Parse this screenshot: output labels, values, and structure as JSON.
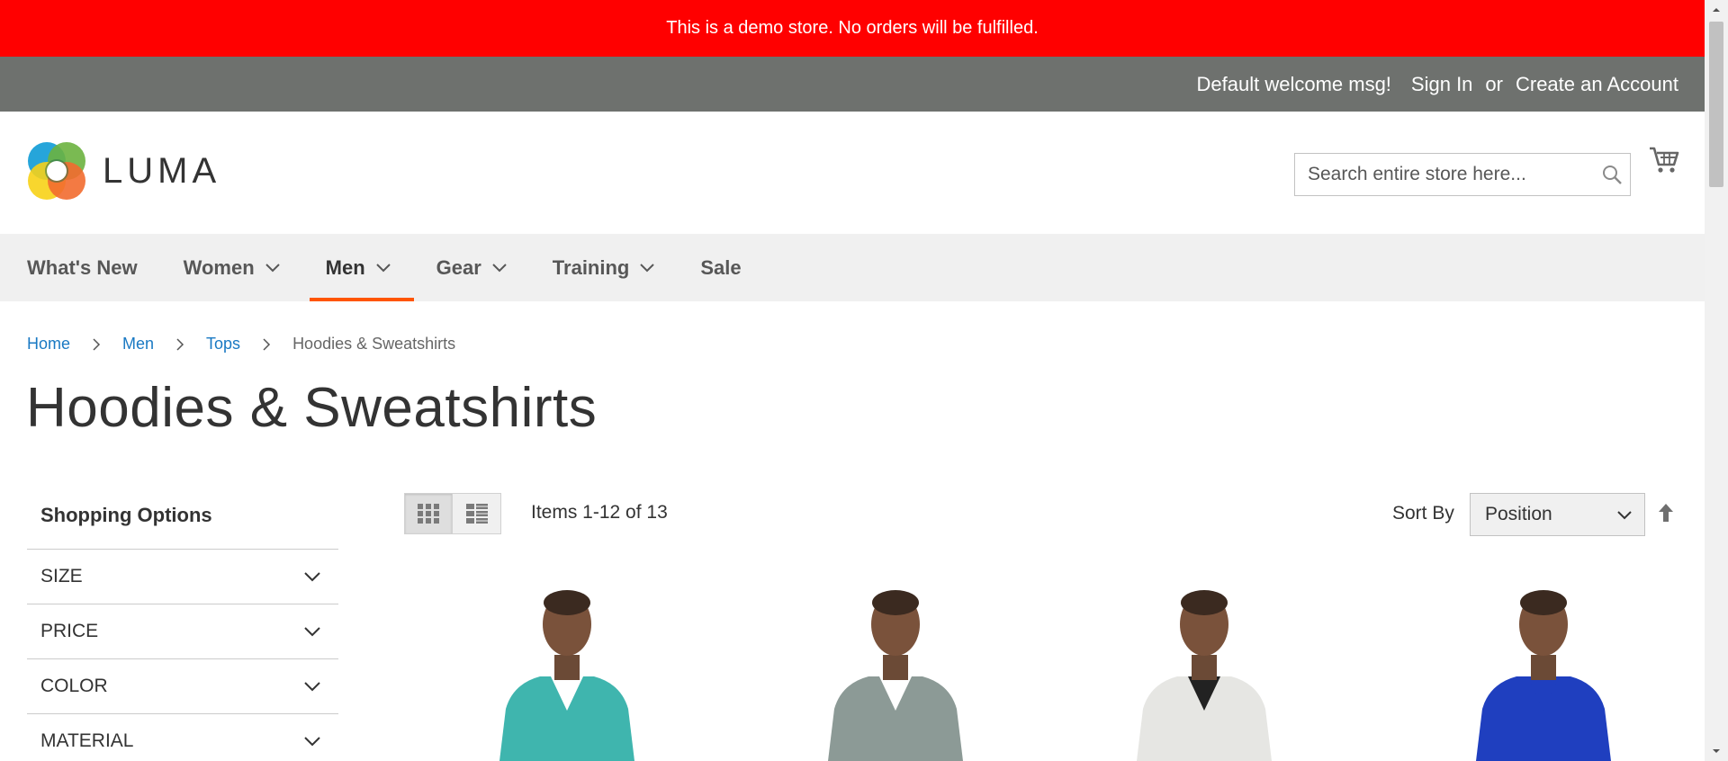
{
  "demo_notice": "This is a demo store. No orders will be fulfilled.",
  "panel": {
    "welcome": "Default welcome msg!",
    "sign_in": "Sign In",
    "or": "or",
    "create_account": "Create an Account"
  },
  "header": {
    "logo_text": "LUMA",
    "search_placeholder": "Search entire store here..."
  },
  "nav": {
    "items": [
      {
        "label": "What's New",
        "has_dropdown": false
      },
      {
        "label": "Women",
        "has_dropdown": true
      },
      {
        "label": "Men",
        "has_dropdown": true,
        "active": true
      },
      {
        "label": "Gear",
        "has_dropdown": true
      },
      {
        "label": "Training",
        "has_dropdown": true
      },
      {
        "label": "Sale",
        "has_dropdown": false
      }
    ]
  },
  "breadcrumb": {
    "home": "Home",
    "men": "Men",
    "tops": "Tops",
    "current": "Hoodies & Sweatshirts"
  },
  "page_title": "Hoodies & Sweatshirts",
  "sidebar": {
    "title": "Shopping Options",
    "filters": [
      "SIZE",
      "PRICE",
      "COLOR",
      "MATERIAL"
    ]
  },
  "toolbar": {
    "amount": "Items 1-12 of 13",
    "sort_label": "Sort By",
    "sort_value": "Position"
  },
  "products": [
    {
      "color": "#3fb5ae",
      "shirt": "#ffffff"
    },
    {
      "color": "#8c9a96",
      "shirt": "#ffffff"
    },
    {
      "color": "#e6e6e3",
      "shirt": "#222222"
    },
    {
      "color": "#1f3fbf",
      "shirt": "#1f3fbf"
    }
  ],
  "colors": {
    "banner": "#ff0000",
    "panel": "#6e716e",
    "accent": "#ff5501",
    "link": "#1979c3"
  }
}
